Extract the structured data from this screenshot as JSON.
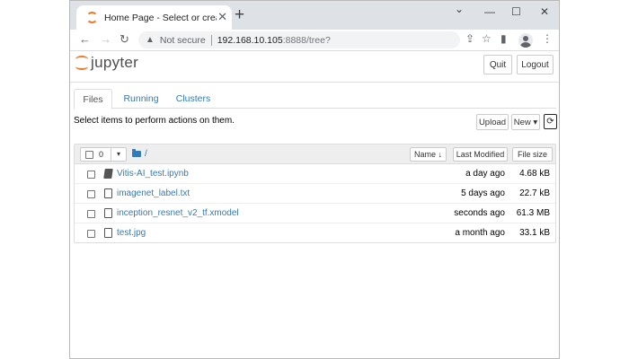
{
  "browser": {
    "tab_title": "Home Page - Select or create a n",
    "tab_close": "✕",
    "new_tab": "+",
    "minimize": "⌄",
    "restore": "—",
    "maximize": "☐",
    "close": "✕",
    "back": "←",
    "forward": "→",
    "reload": "↻",
    "warning_icon": "▲",
    "not_secure": "Not secure",
    "url_host": "192.168.10.105",
    "url_path": ":8888/tree?",
    "share_icon": "⇪",
    "star_icon": "☆",
    "sidepanel_icon": "▮",
    "menu_icon": "⋮"
  },
  "header": {
    "logo_text": "jupyter",
    "quit_label": "Quit",
    "logout_label": "Logout"
  },
  "tabs": [
    {
      "label": "Files"
    },
    {
      "label": "Running"
    },
    {
      "label": "Clusters"
    }
  ],
  "toolbar": {
    "instructions": "Select items to perform actions on them.",
    "upload_label": "Upload",
    "new_label": "New ▾",
    "refresh_icon": "⟳"
  },
  "list": {
    "selected_count": "0",
    "caret": "▾",
    "breadcrumb": "/",
    "col_name": "Name ↓",
    "col_modified": "Last Modified",
    "col_size": "File size",
    "files": [
      {
        "name": "Vitis-AI_test.ipynb",
        "modified": "a day ago",
        "size": "4.68 kB",
        "type": "notebook"
      },
      {
        "name": "imagenet_label.txt",
        "modified": "5 days ago",
        "size": "22.7 kB",
        "type": "file"
      },
      {
        "name": "inception_resnet_v2_tf.xmodel",
        "modified": "seconds ago",
        "size": "61.3 MB",
        "type": "file"
      },
      {
        "name": "test.jpg",
        "modified": "a month ago",
        "size": "33.1 kB",
        "type": "file"
      }
    ]
  },
  "colors": {
    "link": "#337ab7",
    "jupyter_orange": "#f37726"
  }
}
